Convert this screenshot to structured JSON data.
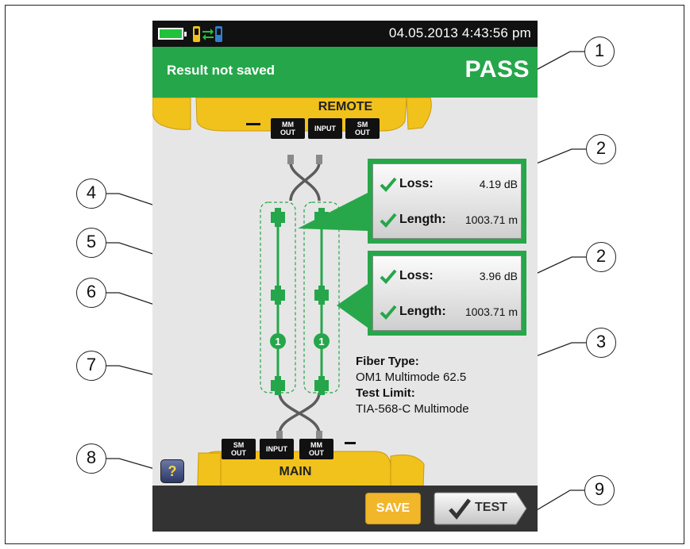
{
  "status": {
    "datetime": "04.05.2013 4:43:56 pm"
  },
  "result": {
    "saved_text": "Result not saved",
    "status": "PASS"
  },
  "remote": {
    "label": "REMOTE",
    "ports": [
      "MM OUT",
      "INPUT",
      "SM OUT"
    ]
  },
  "main": {
    "label": "MAIN",
    "ports": [
      "SM OUT",
      "INPUT",
      "MM OUT"
    ]
  },
  "fibers": [
    {
      "loss_label": "Loss:",
      "loss": "4.19 dB",
      "length_label": "Length:",
      "length": "1003.71 m"
    },
    {
      "loss_label": "Loss:",
      "loss": "3.96 dB",
      "length_label": "Length:",
      "length": "1003.71 m"
    }
  ],
  "connection_number": "1",
  "info": {
    "fiber_type_label": "Fiber Type:",
    "fiber_type": "OM1 Multimode 62.5",
    "test_limit_label": "Test Limit:",
    "test_limit": "TIA-568-C Multimode"
  },
  "help_label": "?",
  "buttons": {
    "save": "SAVE",
    "test": "TEST"
  },
  "callouts": [
    "1",
    "2",
    "2",
    "3",
    "4",
    "5",
    "6",
    "7",
    "8",
    "9"
  ],
  "colors": {
    "green": "#26a64a",
    "yellow": "#f1c21b",
    "dark": "#333333"
  },
  "icons": [
    "battery-icon",
    "link-status-icon",
    "check-icon",
    "help-icon"
  ]
}
